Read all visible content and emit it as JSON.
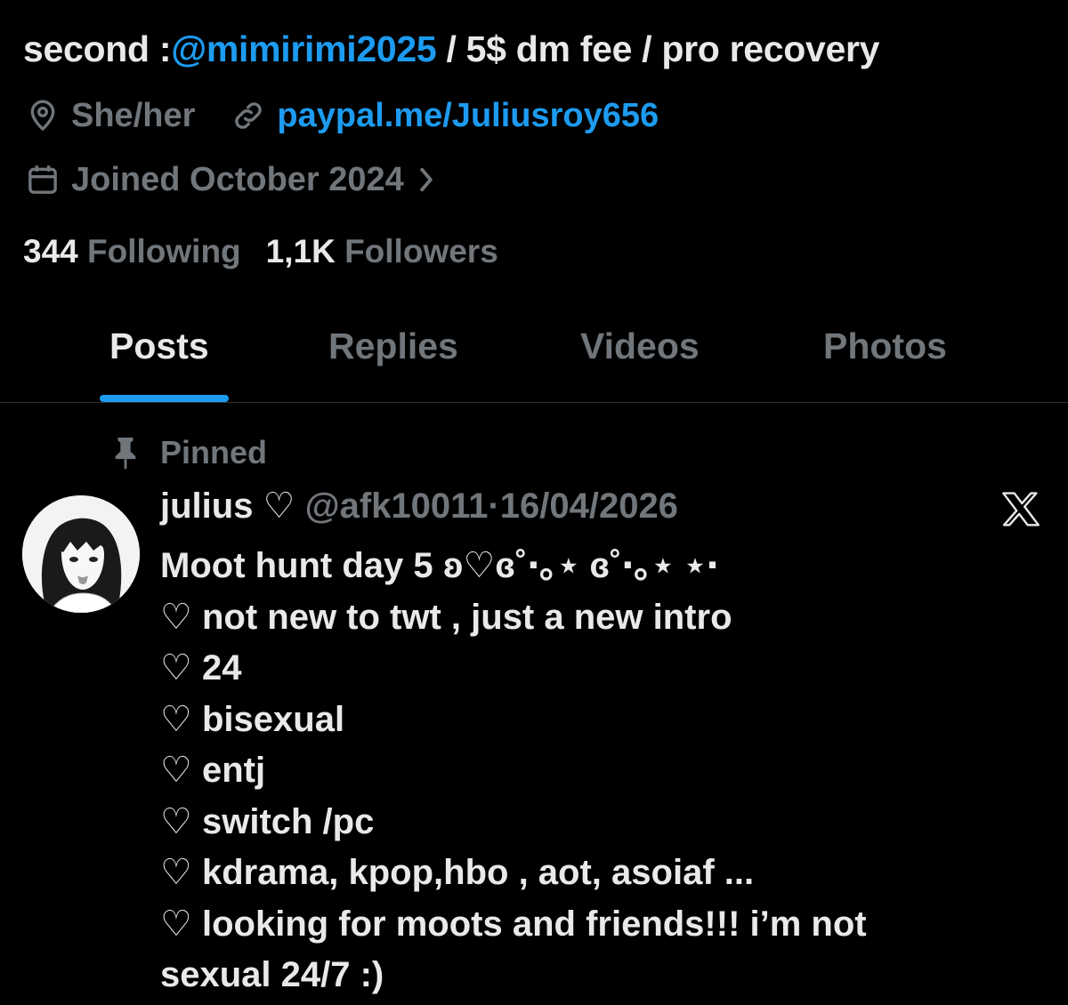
{
  "bio": {
    "prefix": "second :",
    "mention": "@mimirimi2025",
    "suffix": " / 5$ dm fee / pro recovery"
  },
  "profile_meta": {
    "pronouns": "She/her",
    "link": "paypal.me/Juliusroy656",
    "joined": "Joined October 2024"
  },
  "stats": {
    "following_count": "344",
    "following_label": "Following",
    "followers_count": "1,1K",
    "followers_label": "Followers"
  },
  "tabs": [
    {
      "label": "Posts",
      "active": true
    },
    {
      "label": "Replies",
      "active": false
    },
    {
      "label": "Videos",
      "active": false
    },
    {
      "label": "Photos",
      "active": false
    }
  ],
  "post": {
    "pinned_label": "Pinned",
    "author_name": "julius ♡",
    "author_handle": "@afk10011",
    "separator": "·",
    "date": "16/04/2026",
    "lines": [
      "Moot hunt day 5 ʚ♡ɞ˚‧｡⋆ ɞ˚‧｡⋆ ⋆‧",
      "♡ not new to twt , just a new intro",
      "♡ 24",
      "♡ bisexual",
      "♡ entj",
      "♡ switch /pc",
      "♡ kdrama, kpop,hbo , aot, asoiaf ...",
      "♡ looking for moots and friends!!! i’m not",
      "sexual 24/7 :)"
    ]
  },
  "colors": {
    "background": "#000000",
    "text_primary": "#e7e9ea",
    "text_secondary": "#71767b",
    "accent": "#1d9bf0",
    "divider": "#2f3336"
  },
  "icons": {
    "location": "location-pin-icon",
    "link": "link-icon",
    "calendar": "calendar-icon",
    "chevron": "chevron-right-icon",
    "pin": "pushpin-icon",
    "x_logo": "x-logo-icon"
  }
}
